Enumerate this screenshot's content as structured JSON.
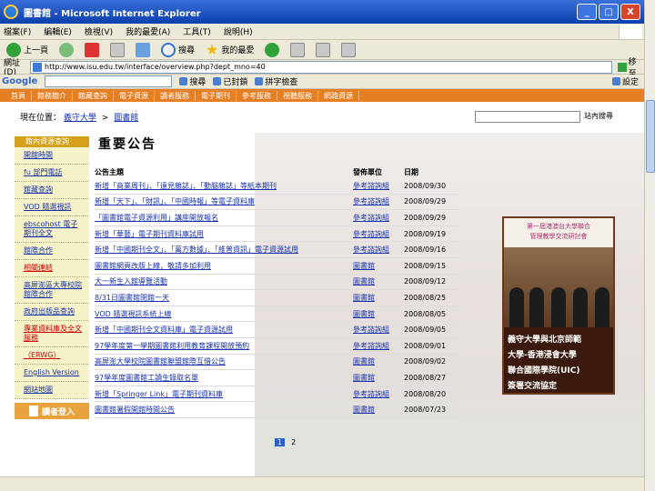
{
  "window": {
    "title": "圖書館 - Microsoft Internet Explorer",
    "min": "_",
    "max": "□",
    "close": "X"
  },
  "menu": [
    "檔案(F)",
    "編輯(E)",
    "檢視(V)",
    "我的最愛(A)",
    "工具(T)",
    "說明(H)"
  ],
  "toolbar": {
    "back": "上一頁",
    "search": "搜尋",
    "favorites": "我的最愛"
  },
  "address": {
    "label": "網址(D)",
    "url": "http://www.isu.edu.tw/interface/overview.php?dept_mno=40",
    "go": "移至"
  },
  "google": {
    "logo": "Google",
    "search_btn": "搜尋",
    "blocked": "已封鎖",
    "spell": "拼字檢查",
    "options": "設定"
  },
  "site_nav": [
    "首頁",
    "館務簡介",
    "館藏查詢",
    "電子資源",
    "讀者服務",
    "電子期刊",
    "參考服務",
    "視聽服務",
    "網路資源"
  ],
  "breadcrumb": {
    "prefix": "現在位置：",
    "home": "義守大學",
    "sep": ">",
    "current": "圖書館"
  },
  "site_search_btn": "站內搜尋",
  "sidebar": {
    "head": "館內資源查詢",
    "items": [
      "開館時間",
      "fu 部門電話",
      "館藏查詢",
      "VOD 隨選視訊",
      "ebscohost 電子期刊全文",
      "館際合作",
      "相關連結",
      "高屏澎區大專校院館際合作",
      "政府出版品查詢",
      "專業資料庫及全文服務",
      "（ERWG）",
      "English Version",
      "網站地圖"
    ],
    "login": "讀者登入"
  },
  "section_title": "重要公告",
  "news": {
    "headers": [
      "公告主題",
      "發佈單位",
      "日期"
    ],
    "rows": [
      [
        "新增「商業周刊」、「遠見雜誌」、「動腦雜誌」等紙本期刊",
        "參考諮詢組",
        "2008/09/30"
      ],
      [
        "新增「天下」、「財訊」、「中國時報」等電子資料庫",
        "參考諮詢組",
        "2008/09/29"
      ],
      [
        "「圖書館電子資源利用」講座開放報名",
        "參考諮詢組",
        "2008/09/29"
      ],
      [
        "新增「華藝」電子期刊資料庫試用",
        "參考諮詢組",
        "2008/09/19"
      ],
      [
        "新增「中國期刊全文」、「萬方數據」、「維普資訊」電子資源試用",
        "參考諮詢組",
        "2008/09/16"
      ],
      [
        "圖書館網頁改版上線，敬請多加利用",
        "圖書館",
        "2008/09/15"
      ],
      [
        "大一新生入館導覽活動",
        "圖書館",
        "2008/09/12"
      ],
      [
        "8/31日圖書館閉館一天",
        "圖書館",
        "2008/08/25"
      ],
      [
        "VOD 隨選視訊系統上線",
        "圖書館",
        "2008/08/05"
      ],
      [
        "新增「中國期刊全文資料庫」電子資源試用",
        "參考諮詢組",
        "2008/09/05"
      ],
      [
        "97學年度第一學期圖書館利用教育課程開放預約",
        "參考諮詢組",
        "2008/09/01"
      ],
      [
        "高屏澎大學校院圖書館聯盟館際互借公告",
        "圖書館",
        "2008/09/02"
      ],
      [
        "97學年度圖書館工讀生錄取名單",
        "圖書館",
        "2008/08/27"
      ],
      [
        "新增「Springer Link」電子期刊資料庫",
        "參考諮詢組",
        "2008/08/20"
      ],
      [
        "圖書館暑假開館時間公告",
        "圖書館",
        "2008/07/23"
      ]
    ]
  },
  "pager": [
    "1",
    "2"
  ],
  "banner": {
    "top_lines": [
      "第一屆港澳台大學聯合",
      "管理教學交流研討會"
    ],
    "lines": [
      "義守大學與北京師範",
      "大學-香港浸會大學",
      "聯合國際學院(UIC)",
      "簽署交流協定"
    ]
  },
  "colors": {
    "nav": "#e67e22",
    "sidebar_head": "#d4a017",
    "sidebar_bg": "#f6f3c9",
    "link": "#1a33a8"
  }
}
